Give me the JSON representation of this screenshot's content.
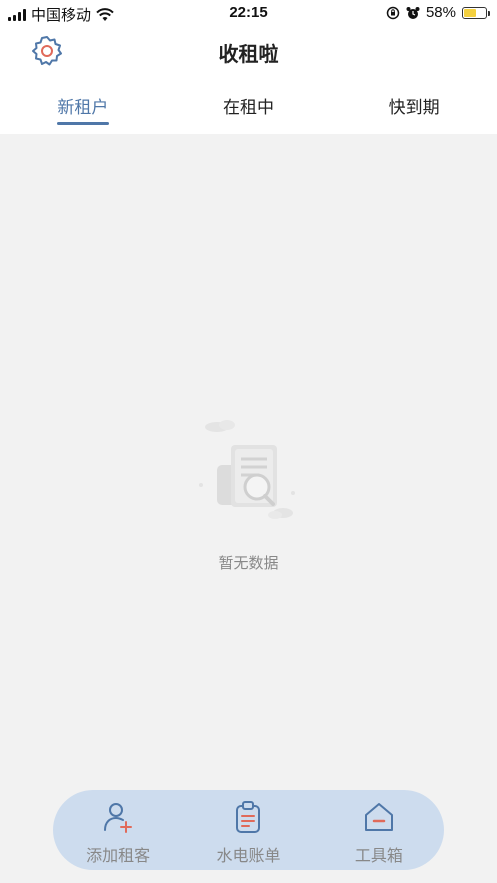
{
  "status_bar": {
    "carrier": "中国移动",
    "time": "22:15",
    "battery_percent": "58%",
    "battery_level": 0.58,
    "icons": [
      "signal-icon",
      "wifi-icon",
      "orientation-lock-icon",
      "alarm-icon",
      "battery-icon",
      "charging-bolt-icon"
    ]
  },
  "header": {
    "title": "收租啦",
    "settings_icon": "gear-icon"
  },
  "tabs": [
    {
      "label": "新租户",
      "active": true
    },
    {
      "label": "在租中",
      "active": false
    },
    {
      "label": "快到期",
      "active": false
    }
  ],
  "empty_state": {
    "icon": "document-search-icon",
    "text": "暂无数据"
  },
  "bottom_nav": [
    {
      "label": "添加租客",
      "icon": "add-user-icon"
    },
    {
      "label": "水电账单",
      "icon": "clipboard-icon"
    },
    {
      "label": "工具箱",
      "icon": "toolbox-home-icon"
    }
  ],
  "colors": {
    "accent": "#4f77a8",
    "icon_red": "#e06a5a",
    "nav_bg": "#cddcee",
    "page_bg": "#f2f2f2"
  }
}
